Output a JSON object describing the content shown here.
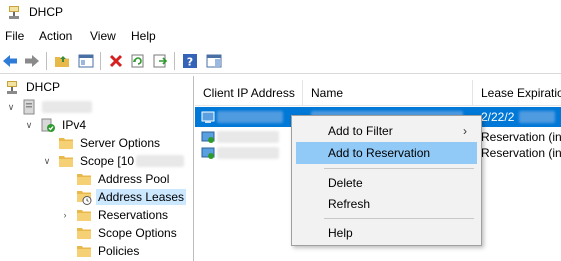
{
  "window": {
    "title": "DHCP"
  },
  "menu": [
    "File",
    "Action",
    "View",
    "Help"
  ],
  "tree": {
    "root": "DHCP",
    "ipv4": "IPv4",
    "server_options": "Server Options",
    "scope": "Scope [10",
    "address_pool": "Address Pool",
    "address_leases": "Address Leases",
    "reservations": "Reservations",
    "scope_options": "Scope Options",
    "policies": "Policies"
  },
  "list": {
    "columns": [
      "Client IP Address",
      "Name",
      "Lease Expiration"
    ],
    "rows": [
      {
        "lease": "2/22/2"
      },
      {
        "lease": "Reservation (in"
      },
      {
        "lease": "Reservation (in"
      }
    ]
  },
  "context_menu": {
    "items": [
      "Add to Filter",
      "Add to Reservation",
      "Delete",
      "Refresh",
      "Help"
    ],
    "hovered": "Add to Reservation"
  },
  "colors": {
    "selection": "#0078d7",
    "hover": "#91c9f7",
    "tree_selected": "#cce8ff"
  }
}
